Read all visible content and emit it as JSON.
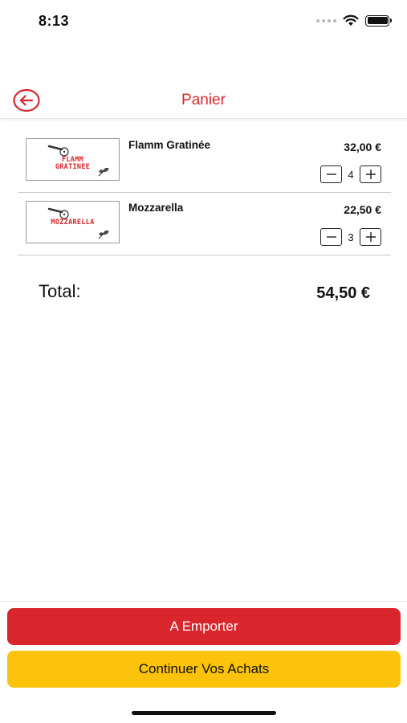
{
  "status_bar": {
    "time": "8:13",
    "signal_icon": "cellular-dots-icon",
    "wifi_icon": "wifi-icon",
    "battery_icon": "battery-icon"
  },
  "header": {
    "title": "Panier",
    "back_icon": "back-arrow-circle-icon",
    "accent_color": "#d9262c"
  },
  "cart": {
    "items": [
      {
        "name": "Flamm Gratinée",
        "image_text_line1": "FLAMM",
        "image_text_line2": "GRATINEE",
        "price": "32,00 €",
        "quantity": "4"
      },
      {
        "name": "Mozzarella",
        "image_text_line1": "MOZZARELLA",
        "image_text_line2": "",
        "price": "22,50 €",
        "quantity": "3"
      }
    ]
  },
  "total": {
    "label": "Total:",
    "value": "54,50 €"
  },
  "actions": {
    "takeaway_label": "A Emporter",
    "continue_label": "Continuer Vos Achats",
    "takeaway_color": "#d9262c",
    "continue_color": "#fbc30b"
  }
}
